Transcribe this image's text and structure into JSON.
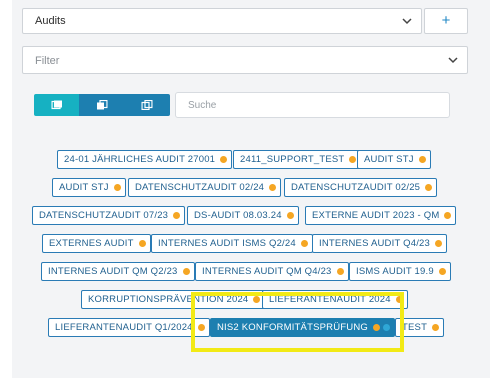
{
  "header": {
    "audits_select_value": "Audits",
    "add_label": "+",
    "filter_placeholder": "Filter"
  },
  "view_toggle": {
    "icons": [
      "card-view-icon",
      "stack-view-icon",
      "copy-view-icon"
    ],
    "active_color": "#16b1c2",
    "inactive_color": "#1d7fb0"
  },
  "search": {
    "placeholder": "Suche",
    "value": ""
  },
  "tags": [
    {
      "label": "24-01 JÄHRLICHES AUDIT 27001",
      "dot": "orange"
    },
    {
      "label": "2411_SUPPORT_TEST",
      "dot": "orange"
    },
    {
      "label": "AUDIT STJ",
      "dot": "orange"
    },
    {
      "label": "AUDIT STJ",
      "dot": "orange"
    },
    {
      "label": "DATENSCHUTZAUDIT 02/24",
      "dot": "orange"
    },
    {
      "label": "DATENSCHUTZAUDIT 02/25",
      "dot": "orange"
    },
    {
      "label": "DATENSCHUTZAUDIT 07/23",
      "dot": "orange"
    },
    {
      "label": "DS-AUDIT 08.03.24",
      "dot": "orange"
    },
    {
      "label": "EXTERNE AUDIT 2023 - QM",
      "dot": "orange"
    },
    {
      "label": "EXTERNES AUDIT",
      "dot": "orange"
    },
    {
      "label": "INTERNES AUDIT ISMS Q2/24",
      "dot": "orange"
    },
    {
      "label": "INTERNES AUDIT Q4/23",
      "dot": "orange"
    },
    {
      "label": "INTERNES AUDIT QM Q2/23",
      "dot": "orange"
    },
    {
      "label": "INTERNES AUDIT QM Q4/23",
      "dot": "orange"
    },
    {
      "label": "ISMS AUDIT 19.9",
      "dot": "orange"
    },
    {
      "label": "KORRUPTIONSPRÄVENTION 2024",
      "dot": "orange"
    },
    {
      "label": "LIEFERANTENAUDIT 2024",
      "dot": "orange"
    },
    {
      "label": "LIEFERANTENAUDIT Q1/2024",
      "dot": "orange"
    },
    {
      "label": "NIS2 KONFORMITÄTSPRÜFUNG",
      "dot": "orange",
      "selected": true
    },
    {
      "label": "TEST",
      "dot": "orange"
    }
  ],
  "colors": {
    "tag_border": "#2a7bb5",
    "tag_text": "#1f5f8e",
    "status_dot": "#f5a623",
    "selected_bg": "#1d7fb0",
    "highlight": "#f2ea16"
  }
}
